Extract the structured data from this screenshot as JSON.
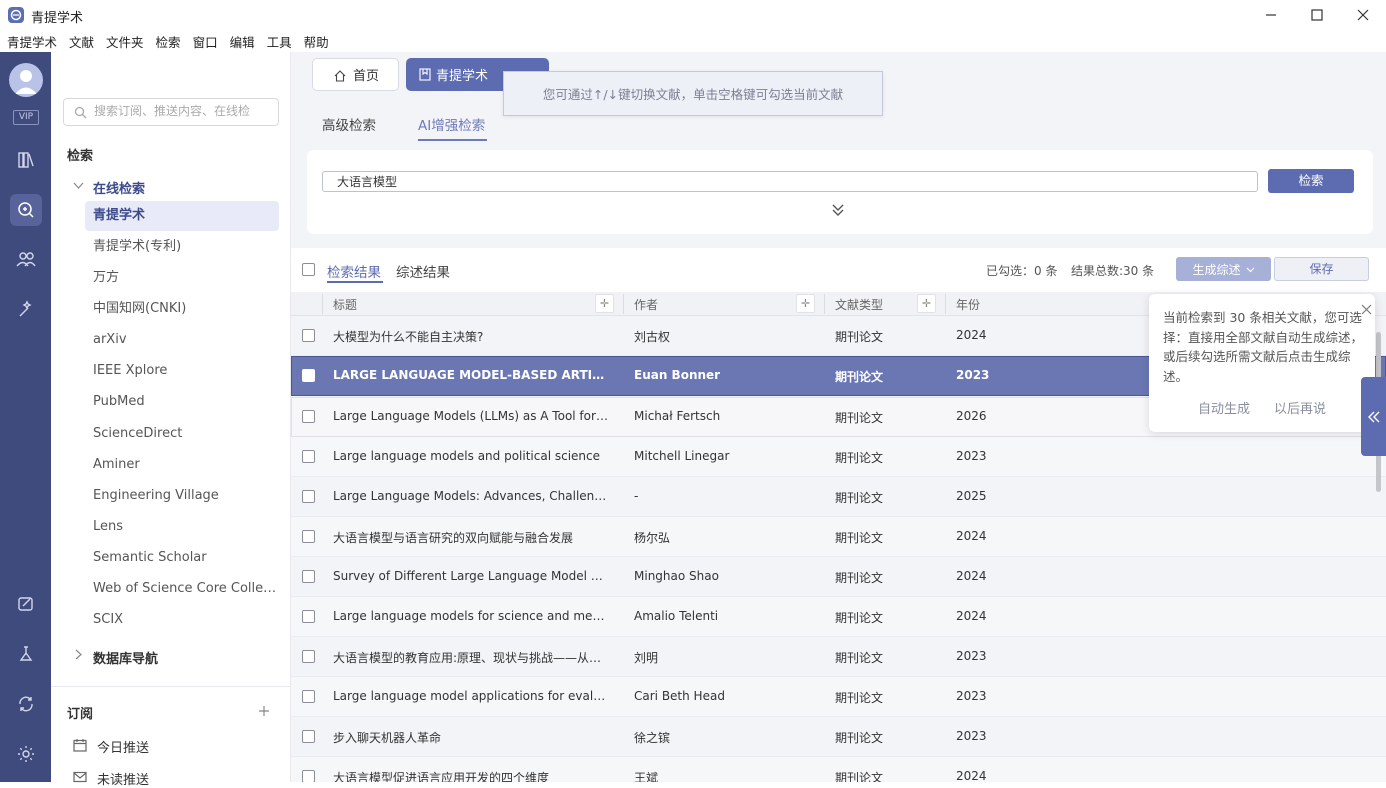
{
  "window": {
    "title": "青提学术"
  },
  "menu": [
    "青提学术",
    "文献",
    "文件夹",
    "检索",
    "窗口",
    "编辑",
    "工具",
    "帮助"
  ],
  "rail": {
    "vip_label": "VIP"
  },
  "nav": {
    "search_placeholder": "搜索订阅、推送内容、在线检",
    "section_search": "检索",
    "group_online": "在线检索",
    "sources": [
      "青提学术",
      "青提学术(专利)",
      "万方",
      "中国知网(CNKI)",
      "arXiv",
      "IEEE Xplore",
      "PubMed",
      "ScienceDirect",
      "Aminer",
      "Engineering Village",
      "Lens",
      "Semantic Scholar",
      "Web of Science Core Collec...",
      "SCIX"
    ],
    "active_source": "青提学术",
    "group_db_nav": "数据库导航",
    "section_subscribe": "订阅",
    "today_push": "今日推送",
    "unread_push": "未读推送"
  },
  "tabs": {
    "home": "首页",
    "current": "青提学术"
  },
  "tooltip": "您可通过↑/↓键切换文献，单击空格键可勾选当前文献",
  "subtabs": {
    "advanced": "高级检索",
    "ai": "AI增强检索"
  },
  "search": {
    "query": "大语言模型",
    "button": "检索"
  },
  "results_bar": {
    "tab_results": "检索结果",
    "tab_summary": "综述结果",
    "selected": "已勾选：0 条",
    "total": "结果总数:30 条",
    "generate": "生成综述",
    "save": "保存"
  },
  "columns": {
    "title": "标题",
    "author": "作者",
    "type": "文献类型",
    "year": "年份"
  },
  "rows": [
    {
      "title": "大模型为什么不能自主决策?",
      "author": "刘古权",
      "type": "期刊论文",
      "year": "2024"
    },
    {
      "title": "LARGE LANGUAGE MODEL-BASED ARTIFICIAL INTELLIGENCE",
      "author": "Euan Bonner",
      "type": "期刊论文",
      "year": "2023"
    },
    {
      "title": "Large Language Models (LLMs) as A Tool for Supporting",
      "author": "Michał Fertsch",
      "type": "期刊论文",
      "year": "2026"
    },
    {
      "title": "Large language models and political science",
      "author": "Mitchell Linegar",
      "type": "期刊论文",
      "year": "2023"
    },
    {
      "title": "Large Language Models: Advances, Challenges, and Future",
      "author": "-",
      "type": "期刊论文",
      "year": "2025"
    },
    {
      "title": "大语言模型与语言研究的双向赋能与融合发展",
      "author": "杨尔弘",
      "type": "期刊论文",
      "year": "2024"
    },
    {
      "title": "Survey of Different Large Language Model Architectures",
      "author": "Minghao Shao",
      "type": "期刊论文",
      "year": "2024"
    },
    {
      "title": "Large language models for science and medicine",
      "author": "Amalio Telenti",
      "type": "期刊论文",
      "year": "2024"
    },
    {
      "title": "大语言模型的教育应用:原理、现状与挑战——从轻量级",
      "author": "刘明",
      "type": "期刊论文",
      "year": "2023"
    },
    {
      "title": "Large language model applications for evaluation: opportunities",
      "author": "Cari Beth Head",
      "type": "期刊论文",
      "year": "2023"
    },
    {
      "title": "步入聊天机器人革命",
      "author": "徐之镔",
      "type": "期刊论文",
      "year": "2023"
    },
    {
      "title": "大语言模型促进语言应用开发的四个维度",
      "author": "王斌",
      "type": "期刊论文",
      "year": "2024"
    }
  ],
  "popup": {
    "text": "当前检索到 30 条相关文献，您可选择：直接用全部文献自动生成综述，或后续勾选所需文献后点击生成综述。",
    "auto": "自动生成",
    "later": "以后再说"
  },
  "colors": {
    "accent": "#5d6cb0",
    "rail": "#3f4a7d",
    "selected_row": "#6a77b3"
  }
}
